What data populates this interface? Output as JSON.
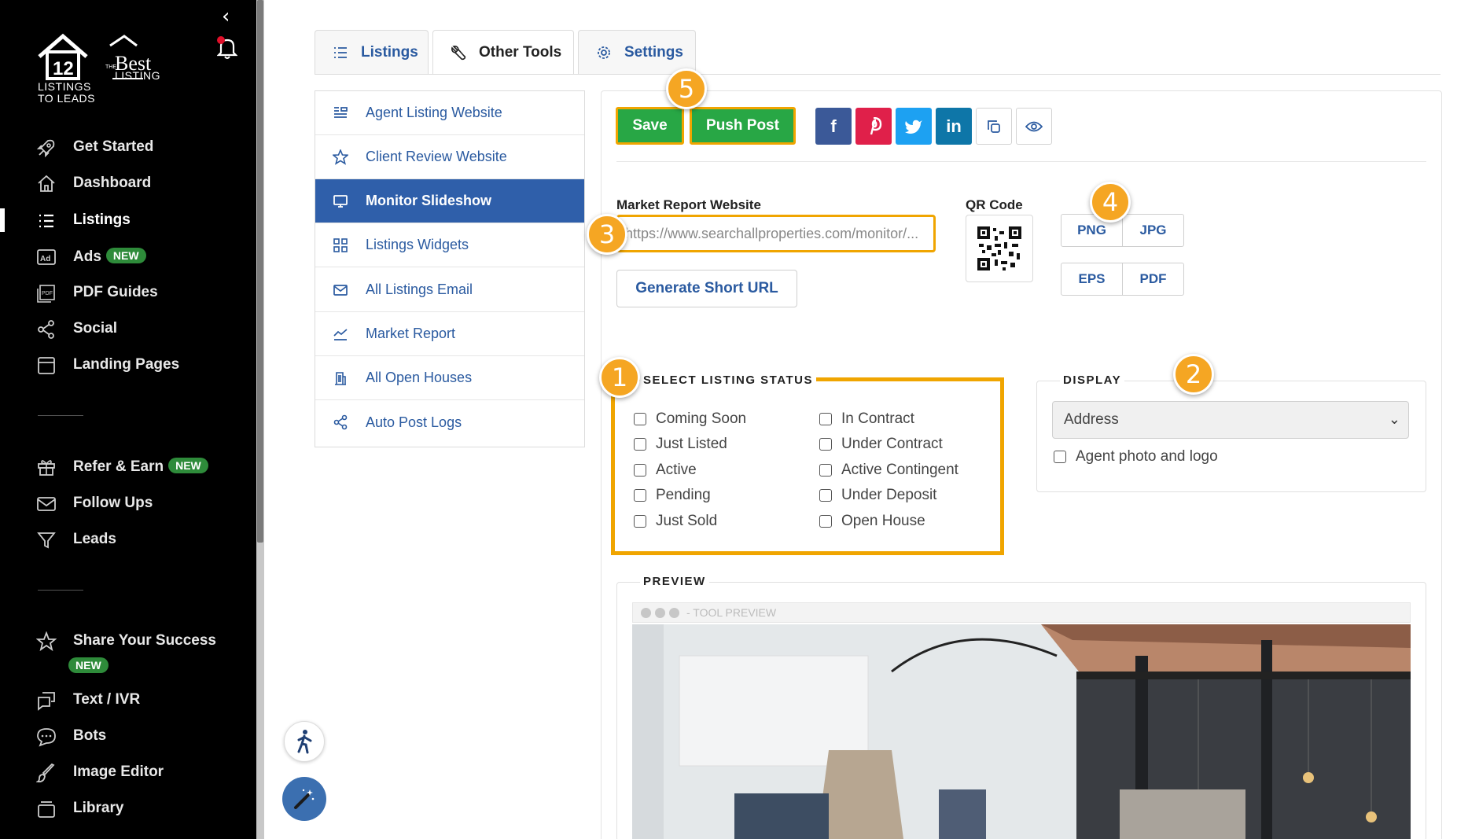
{
  "sidebar": {
    "logo": {
      "brand1_line1": "LISTINGS",
      "brand1_line2": "TO LEADS",
      "brand2_small": "THE",
      "brand2_main": "Best",
      "brand2_sub": "LISTING"
    },
    "items": [
      {
        "label": "Get Started",
        "icon": "rocket-icon"
      },
      {
        "label": "Dashboard",
        "icon": "home-icon"
      },
      {
        "label": "Listings",
        "icon": "list-icon",
        "active": true
      },
      {
        "label": "Ads",
        "icon": "ad-icon",
        "badge": "NEW"
      },
      {
        "label": "PDF Guides",
        "icon": "pdf-icon"
      },
      {
        "label": "Social",
        "icon": "share-icon"
      },
      {
        "label": "Landing Pages",
        "icon": "page-icon"
      },
      {
        "label": "Refer & Earn",
        "icon": "gift-icon",
        "badge": "NEW"
      },
      {
        "label": "Follow Ups",
        "icon": "mail-icon"
      },
      {
        "label": "Leads",
        "icon": "filter-icon"
      },
      {
        "label": "Share Your Success",
        "icon": "star-icon",
        "badge": "NEW"
      },
      {
        "label": "Text / IVR",
        "icon": "chat-icon"
      },
      {
        "label": "Bots",
        "icon": "bot-icon"
      },
      {
        "label": "Image Editor",
        "icon": "brush-icon"
      },
      {
        "label": "Library",
        "icon": "library-icon"
      }
    ]
  },
  "tabs": [
    {
      "label": "Listings",
      "icon": "list-icon"
    },
    {
      "label": "Other Tools",
      "icon": "tools-icon",
      "active": true
    },
    {
      "label": "Settings",
      "icon": "gear-icon"
    }
  ],
  "submenu": [
    {
      "label": "Agent Listing Website",
      "icon": "website-icon"
    },
    {
      "label": "Client Review Website",
      "icon": "star-icon"
    },
    {
      "label": "Monitor Slideshow",
      "icon": "monitor-icon",
      "active": true
    },
    {
      "label": "Listings Widgets",
      "icon": "widgets-icon"
    },
    {
      "label": "All Listings Email",
      "icon": "envelope-icon"
    },
    {
      "label": "Market Report",
      "icon": "chart-icon"
    },
    {
      "label": "All Open Houses",
      "icon": "building-icon"
    },
    {
      "label": "Auto Post Logs",
      "icon": "share-icon"
    }
  ],
  "toolbar": {
    "save_label": "Save",
    "push_label": "Push Post"
  },
  "share": {
    "facebook": "f",
    "linkedin": "in"
  },
  "market_report": {
    "label": "Market Report Website",
    "url": "https://www.searchallproperties.com/monitor/...",
    "short_url_label": "Generate Short URL"
  },
  "qr": {
    "label": "QR Code",
    "formats": [
      "PNG",
      "JPG",
      "EPS",
      "PDF"
    ]
  },
  "listing_status": {
    "title": "SELECT LISTING STATUS",
    "left": [
      "Coming Soon",
      "Just Listed",
      "Active",
      "Pending",
      "Just Sold"
    ],
    "right": [
      "In Contract",
      "Under Contract",
      "Active Contingent",
      "Under Deposit",
      "Open House"
    ]
  },
  "display": {
    "title": "DISPLAY",
    "selected": "Address",
    "agent_photo_label": "Agent photo and logo"
  },
  "preview": {
    "title": "PREVIEW",
    "bar_label": "- TOOL PREVIEW"
  },
  "callouts": [
    "1",
    "2",
    "3",
    "4",
    "5"
  ],
  "colors": {
    "accent": "#2f5faa",
    "highlight": "#f0a500",
    "green": "#28a745",
    "facebook": "#3b5998",
    "pinterest": "#e0204a",
    "twitter": "#1da1f2",
    "linkedin": "#0e76a8"
  }
}
